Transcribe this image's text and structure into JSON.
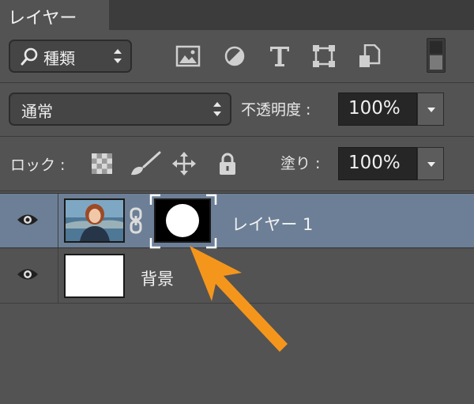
{
  "panel": {
    "tab_label": "レイヤー"
  },
  "filter": {
    "kind_label": "種類",
    "filter_icons": [
      "image-filter-icon",
      "adjustment-filter-icon",
      "type-filter-icon",
      "shape-filter-icon",
      "smart-object-filter-icon"
    ]
  },
  "blend": {
    "mode_label": "通常",
    "opacity_label": "不透明度 :",
    "opacity_value": "100%",
    "fill_label": "塗り :",
    "fill_value": "100%"
  },
  "lock": {
    "label": "ロック :",
    "icons": [
      "lock-transparent-pixels-icon",
      "lock-image-pixels-icon",
      "lock-position-icon",
      "lock-all-icon"
    ]
  },
  "layers": [
    {
      "name": "レイヤー 1",
      "selected": true,
      "has_mask": true
    },
    {
      "name": "背景",
      "selected": false,
      "has_mask": false
    }
  ],
  "colors": {
    "panel_bg": "#535353",
    "selected_row": "#6c7f96",
    "annotation_arrow": "#f5961c"
  }
}
